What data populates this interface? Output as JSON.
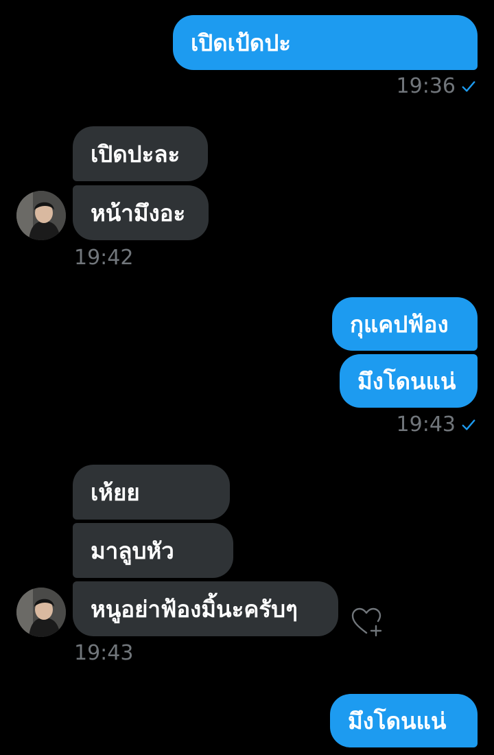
{
  "conversation": {
    "messages": [
      {
        "direction": "sent",
        "text": "เปิดเป้ดปะ"
      },
      {
        "direction": "received",
        "text": "เปิดปะละ"
      },
      {
        "direction": "received",
        "text": "หน้ามึงอะ"
      },
      {
        "direction": "sent",
        "text": "กุแคปฟ้อง"
      },
      {
        "direction": "sent",
        "text": "มึงโดนแน่"
      },
      {
        "direction": "received",
        "text": "เห้ยย"
      },
      {
        "direction": "received",
        "text": "มาลูบหัว"
      },
      {
        "direction": "received",
        "text": "หนูอย่าฟ้องมิ้นะครับๆ"
      },
      {
        "direction": "sent",
        "text": "มึงโดนแน่"
      }
    ],
    "timestamps": {
      "group1": "19:36",
      "group2": "19:42",
      "group3": "19:43",
      "group4": "19:43"
    }
  },
  "icons": {
    "read_receipt": "check-icon",
    "react": "heart-plus-icon",
    "avatar": "avatar"
  },
  "colors": {
    "background": "#000000",
    "sent_bubble": "#1d9bf0",
    "received_bubble": "#2f3336",
    "timestamp": "#71767b",
    "check": "#1d9bf0"
  }
}
